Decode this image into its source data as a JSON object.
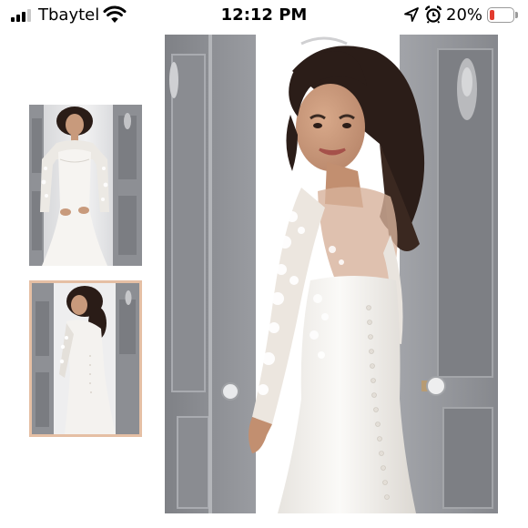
{
  "status_bar": {
    "carrier": "Tbaytel",
    "time": "12:12 PM",
    "battery_percent": "20%",
    "battery_level": 0.2,
    "signal_bars": 3,
    "icons": [
      "cellular-signal-icon",
      "wifi-icon",
      "location-arrow-icon",
      "alarm-clock-icon",
      "battery-icon"
    ],
    "battery_color": "#e23b2e"
  },
  "gallery": {
    "thumbnails": [
      {
        "name": "thumbnail-front-view",
        "selected": false
      },
      {
        "name": "thumbnail-back-view",
        "selected": true
      }
    ],
    "selected_border_color": "#e5bfa4"
  }
}
